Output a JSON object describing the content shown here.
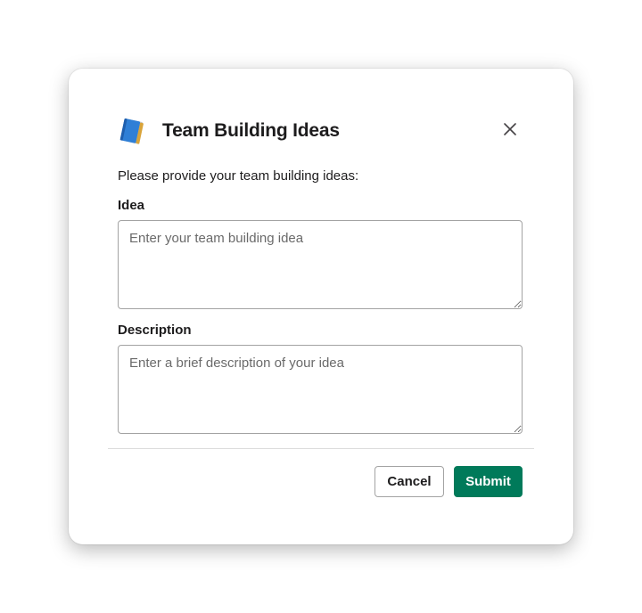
{
  "modal": {
    "title": "Team Building Ideas",
    "title_icon": "blue-book-icon",
    "close_icon": "close-icon",
    "intro_text": "Please provide your team building ideas:"
  },
  "form": {
    "idea": {
      "label": "Idea",
      "value": "",
      "placeholder": "Enter your team building idea"
    },
    "description": {
      "label": "Description",
      "value": "",
      "placeholder": "Enter a brief description of your idea"
    }
  },
  "footer": {
    "cancel_label": "Cancel",
    "submit_label": "Submit"
  },
  "colors": {
    "primary": "#007a5a",
    "text": "#1d1c1d",
    "border": "#a3a3a3"
  }
}
